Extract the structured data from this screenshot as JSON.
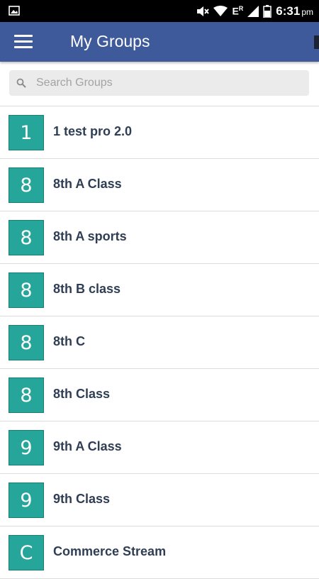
{
  "status_bar": {
    "time": "6:31",
    "ampm": "pm",
    "network_label": "E",
    "network_sup": "R"
  },
  "app_bar": {
    "title": "My Groups"
  },
  "search": {
    "placeholder": "Search Groups"
  },
  "groups": [
    {
      "initial": "1",
      "name": "1 test pro 2.0"
    },
    {
      "initial": "8",
      "name": "8th A Class"
    },
    {
      "initial": "8",
      "name": "8th A sports"
    },
    {
      "initial": "8",
      "name": "8th B class"
    },
    {
      "initial": "8",
      "name": "8th C"
    },
    {
      "initial": "8",
      "name": "8th Class"
    },
    {
      "initial": "9",
      "name": "9th A Class"
    },
    {
      "initial": "9",
      "name": "9th Class"
    },
    {
      "initial": "C",
      "name": "Commerce Stream"
    }
  ],
  "colors": {
    "app_bar": "#3F5A9B",
    "badge": "#26A69A",
    "label_text": "#2f3e54"
  }
}
